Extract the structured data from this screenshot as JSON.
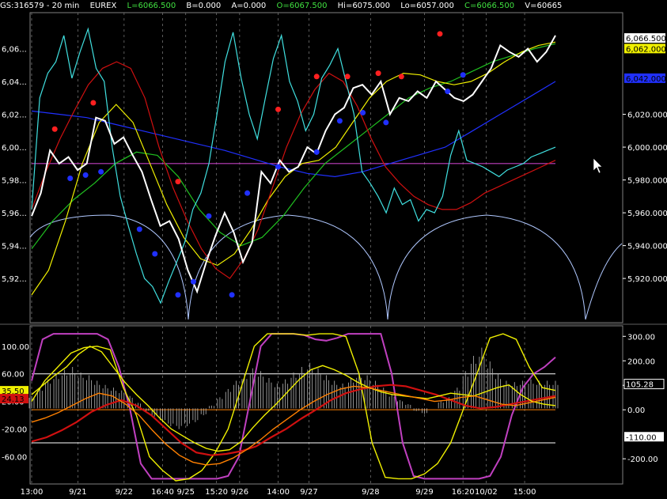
{
  "header": {
    "symbol": "GS:316579 - 20 min",
    "exchange": "EUREX",
    "last": "L=6066.500",
    "bid": "B=0.000",
    "ask": "A=0.000",
    "open": "O=6067.500",
    "high": "Hi=6075.000",
    "low": "Lo=6057.000",
    "close": "C=6066.500",
    "volume": "V=60665"
  },
  "colors": {
    "background": "#000000",
    "price": "#ffffff",
    "cyan": "#40e0e0",
    "red": "#d01010",
    "yellow": "#f0f000",
    "green": "#20c020",
    "blue": "#2030ff",
    "magenta": "#c040c0",
    "orange": "#ff8000",
    "arc": "#b0c8ff"
  },
  "chart_data": [
    {
      "type": "line",
      "panel": "price",
      "ylim": [
        5895,
        6080
      ],
      "y_ticks": [
        "6,06...",
        "6,04...",
        "6,02...",
        "6,00...",
        "5,98...",
        "5,96...",
        "5,94...",
        "5,92..."
      ],
      "y_tick_values": [
        6060,
        6040,
        6020,
        6000,
        5980,
        5960,
        5940,
        5920
      ],
      "right_ticks": [
        "6,020.000",
        "6,000.000",
        "5,980.000",
        "5,960.000",
        "5,940.000",
        "5,920.000"
      ],
      "right_tick_values": [
        6020,
        6000,
        5980,
        5960,
        5940,
        5920
      ],
      "right_labels": [
        {
          "text": "6,066.500",
          "value": 6066.5,
          "bg": "#ffffff",
          "fg": "#000000"
        },
        {
          "text": "6,062.000",
          "value": 6062,
          "bg": "#f0f000",
          "fg": "#000000"
        },
        {
          "text": "6,042.000",
          "value": 6042,
          "bg": "#2030ff",
          "fg": "#000000"
        }
      ],
      "x_labels": [
        "13:00",
        "9/21",
        "9/22",
        "16:40",
        "9/25",
        "15:20",
        "9/26",
        "14:00",
        "9/27",
        "9/28",
        "9/29",
        "16:20",
        "10/02",
        "15:00"
      ],
      "x_label_index": [
        0,
        6,
        12,
        17,
        20,
        24,
        27,
        32,
        36,
        44,
        51,
        56,
        59,
        64
      ],
      "x_count": 69,
      "horizontal_line": 5990,
      "series": [
        {
          "key": "price",
          "color": "#ffffff",
          "values": [
            5958,
            5972,
            5998,
            5990,
            5994,
            5986,
            5990,
            6018,
            6016,
            6002,
            6006,
            5995,
            5985,
            5968,
            5952,
            5955,
            5944,
            5925,
            5912,
            5930,
            5946,
            5960,
            5948,
            5930,
            5942,
            5985,
            5978,
            5992,
            5985,
            5988,
            6000,
            5996,
            6010,
            6020,
            6024,
            6036,
            6038,
            6032,
            6040,
            6020,
            6030,
            6028,
            6034,
            6030,
            6040,
            6035,
            6030,
            6028,
            6032,
            6040,
            6048,
            6062,
            6058,
            6055,
            6060,
            6052,
            6058,
            6068
          ]
        },
        {
          "key": "cyan",
          "color": "#40e0e0",
          "values": [
            5962,
            6030,
            6045,
            6052,
            6068,
            6042,
            6058,
            6072,
            6048,
            6040,
            6000,
            5970,
            5952,
            5935,
            5920,
            5915,
            5905,
            5918,
            5930,
            5942,
            5962,
            5972,
            5990,
            6020,
            6052,
            6070,
            6042,
            6020,
            6005,
            6030,
            6054,
            6068,
            6040,
            6028,
            6010,
            6020,
            6042,
            6050,
            6060,
            6040,
            6020,
            5985,
            5978,
            5970,
            5960,
            5975,
            5965,
            5968,
            5955,
            5962,
            5960,
            5970,
            5995,
            6010,
            5992,
            5990,
            5988,
            5985,
            5982,
            5986,
            5988,
            5990,
            5994,
            5996,
            5998,
            6000
          ]
        },
        {
          "key": "red",
          "color": "#d01010",
          "values": [
            5962,
            5985,
            6005,
            6022,
            6038,
            6048,
            6052,
            6048,
            6030,
            6000,
            5975,
            5955,
            5938,
            5926,
            5920,
            5932,
            5950,
            5975,
            6000,
            6020,
            6035,
            6045,
            6040,
            6025,
            6005,
            5988,
            5978,
            5970,
            5965,
            5962,
            5962,
            5966,
            5972,
            5976,
            5980,
            5984,
            5988,
            5992
          ]
        },
        {
          "key": "yellow",
          "color": "#f0f000",
          "values": [
            5910,
            5925,
            5955,
            5990,
            6015,
            6026,
            6015,
            5990,
            5965,
            5945,
            5932,
            5928,
            5935,
            5950,
            5968,
            5982,
            5990,
            5992,
            6000,
            6015,
            6030,
            6040,
            6045,
            6044,
            6040,
            6038,
            6040,
            6045,
            6052,
            6058,
            6062,
            6064
          ]
        },
        {
          "key": "green",
          "color": "#20c020",
          "values": [
            5938,
            5955,
            5968,
            5978,
            5990,
            5997,
            5995,
            5982,
            5962,
            5948,
            5940,
            5945,
            5958,
            5975,
            5990,
            6000,
            6010,
            6020,
            6030,
            6036,
            6040,
            6046,
            6052,
            6056,
            6060,
            6063
          ]
        },
        {
          "key": "blue",
          "color": "#2030ff",
          "values": [
            6022,
            6020,
            6018,
            6014,
            6010,
            6006,
            6002,
            5998,
            5993,
            5988,
            5984,
            5982,
            5985,
            5990,
            5995,
            6000,
            6010,
            6020,
            6030,
            6040
          ]
        }
      ],
      "dots": [
        {
          "color": "#ff2020",
          "points": [
            [
              3,
              6011
            ],
            [
              8,
              6027
            ],
            [
              19,
              5979
            ],
            [
              32,
              6023
            ],
            [
              37,
              6043
            ],
            [
              41,
              6043
            ],
            [
              45,
              6045
            ],
            [
              48,
              6043
            ],
            [
              53,
              6069
            ]
          ]
        },
        {
          "color": "#2030ff",
          "points": [
            [
              5,
              5981
            ],
            [
              7,
              5983
            ],
            [
              9,
              5985
            ],
            [
              14,
              5950
            ],
            [
              16,
              5935
            ],
            [
              19,
              5910
            ],
            [
              21,
              5918
            ],
            [
              23,
              5958
            ],
            [
              26,
              5910
            ],
            [
              28,
              5972
            ],
            [
              32,
              5988
            ],
            [
              37,
              5997
            ],
            [
              40,
              6016
            ],
            [
              43,
              6021
            ],
            [
              46,
              6015
            ],
            [
              54,
              6034
            ],
            [
              56,
              6044
            ]
          ]
        }
      ]
    },
    {
      "type": "line",
      "panel": "oscillator",
      "ylim": [
        -95,
        125
      ],
      "y_ticks": [
        "100.00",
        "60.00",
        "20.00",
        "-20.00",
        "-60.00"
      ],
      "y_tick_values": [
        100,
        60,
        20,
        -20,
        -60
      ],
      "left_tags": [
        {
          "text": "35.50",
          "value": 35.5,
          "bg": "#f0f000",
          "fg": "#000000"
        },
        {
          "text": "24.13",
          "value": 24.1,
          "bg": "#d01010",
          "fg": "#000000"
        }
      ],
      "right_ticks": [
        "300.00",
        "200.00",
        "100.00",
        "0.00",
        "-200.00"
      ],
      "right_tick_values": [
        300,
        200,
        100,
        0,
        -200
      ],
      "right_labels": [
        {
          "text": "105.28",
          "value": 105.28,
          "bg": "#000000",
          "fg": "#ffffff"
        },
        {
          "text": "-110.00",
          "value": -110,
          "bg": "#ffffff",
          "fg": "#000000"
        }
      ],
      "levels": [
        {
          "value": 60,
          "color": "#ffffff"
        },
        {
          "value": 8,
          "color": "#ff8000"
        },
        {
          "value": -40,
          "color": "#ffffff"
        }
      ],
      "histogram": [
        18,
        30,
        42,
        50,
        56,
        60,
        52,
        48,
        40,
        34,
        30,
        26,
        18,
        8,
        -4,
        -12,
        -20,
        -26,
        -30,
        -26,
        -20,
        -10,
        4,
        16,
        28,
        40,
        50,
        58,
        54,
        44,
        36,
        42,
        52,
        60,
        66,
        58,
        48,
        40,
        36,
        44,
        52,
        48,
        40,
        30,
        20,
        12,
        6,
        -4,
        -8,
        0,
        10,
        16,
        30,
        54,
        76,
        88,
        68,
        50,
        40,
        38,
        40,
        42,
        40,
        40,
        40
      ],
      "series": [
        {
          "key": "magenta",
          "color": "#c040c0",
          "values": [
            50,
            110,
            118,
            118,
            118,
            118,
            118,
            110,
            70,
            10,
            -70,
            -92,
            -92,
            -92,
            -92,
            -92,
            -92,
            -92,
            -88,
            -60,
            20,
            100,
            118,
            118,
            118,
            116,
            110,
            108,
            112,
            118,
            118,
            118,
            118,
            60,
            -40,
            -88,
            -92,
            -92,
            -92,
            -92,
            -92,
            -92,
            -88,
            -60,
            0,
            40,
            60,
            70,
            84
          ]
        },
        {
          "key": "yellow",
          "color": "#f0f000",
          "values": [
            20,
            50,
            70,
            90,
            98,
            100,
            95,
            40,
            0,
            -60,
            -80,
            -95,
            -92,
            -80,
            -55,
            -20,
            40,
            100,
            118,
            118,
            118,
            116,
            118,
            118,
            114,
            60,
            -40,
            -90,
            -92,
            -92,
            -85,
            -70,
            -40,
            10,
            60,
            112,
            118,
            110,
            70,
            40,
            36
          ]
        },
        {
          "key": "red",
          "color": "#d01010",
          "values": [
            -38,
            -32,
            -22,
            -10,
            5,
            15,
            22,
            14,
            0,
            -20,
            -40,
            -54,
            -58,
            -56,
            -52,
            -45,
            -32,
            -20,
            -5,
            8,
            22,
            32,
            38,
            42,
            44,
            42,
            36,
            30,
            22,
            14,
            10,
            12,
            16,
            20,
            24,
            28
          ]
        },
        {
          "key": "yellow_osc",
          "color": "#f0f000",
          "values": [
            30,
            44,
            58,
            70,
            88,
            100,
            92,
            70,
            48,
            30,
            14,
            -4,
            -20,
            -30,
            -40,
            -48,
            -52,
            -50,
            -38,
            -18,
            0,
            16,
            34,
            52,
            66,
            72,
            66,
            58,
            48,
            40,
            34,
            30,
            28,
            26,
            24,
            28,
            32,
            30,
            28,
            34,
            40,
            44,
            30,
            20,
            16,
            14
          ]
        },
        {
          "key": "orange",
          "color": "#ff8000",
          "values": [
            -10,
            -4,
            4,
            14,
            24,
            32,
            28,
            16,
            0,
            -22,
            -42,
            -58,
            -68,
            -72,
            -70,
            -62,
            -50,
            -36,
            -20,
            -6,
            8,
            20,
            30,
            38,
            42,
            40,
            36,
            32,
            28,
            24,
            20,
            22,
            26,
            28,
            22,
            16,
            14,
            18,
            22,
            26
          ]
        }
      ]
    }
  ]
}
